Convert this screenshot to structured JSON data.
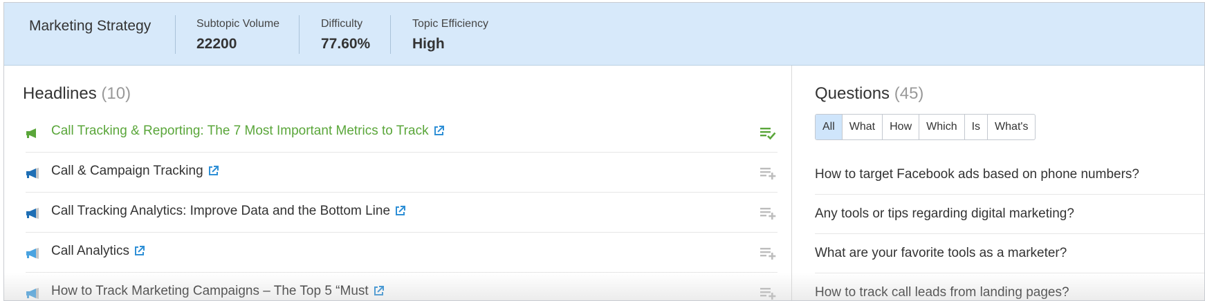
{
  "header": {
    "title": "Marketing Strategy",
    "metrics": [
      {
        "label": "Subtopic Volume",
        "value": "22200"
      },
      {
        "label": "Difficulty",
        "value": "77.60%"
      },
      {
        "label": "Topic Efficiency",
        "value": "High"
      }
    ]
  },
  "headlines": {
    "title": "Headlines",
    "count": "(10)",
    "items": [
      {
        "text": "Call Tracking & Reporting: The 7 Most Important Metrics to Track",
        "icon": "megaphone-green-icon",
        "active": true
      },
      {
        "text": "Call & Campaign Tracking",
        "icon": "megaphone-blue-icon"
      },
      {
        "text": "Call Tracking Analytics: Improve Data and the Bottom Line",
        "icon": "megaphone-blue-icon"
      },
      {
        "text": "Call Analytics",
        "icon": "megaphone-lightblue-icon"
      },
      {
        "text": "How to Track Marketing Campaigns – The Top 5 “Must",
        "icon": "megaphone-lightblue-icon"
      }
    ]
  },
  "questions": {
    "title": "Questions",
    "count": "(45)",
    "filters": [
      "All",
      "What",
      "How",
      "Which",
      "Is",
      "What's"
    ],
    "selected_filter": "All",
    "items": [
      "How to target Facebook ads based on phone numbers?",
      "Any tools or tips regarding digital marketing?",
      "What are your favorite tools as a marketer?",
      "How to track call leads from landing pages?"
    ]
  },
  "colors": {
    "header_bg": "#d7e9fa",
    "active_green": "#5aa63a",
    "link_blue": "#2e8fd6",
    "filter_selected": "#cfe5fb"
  }
}
